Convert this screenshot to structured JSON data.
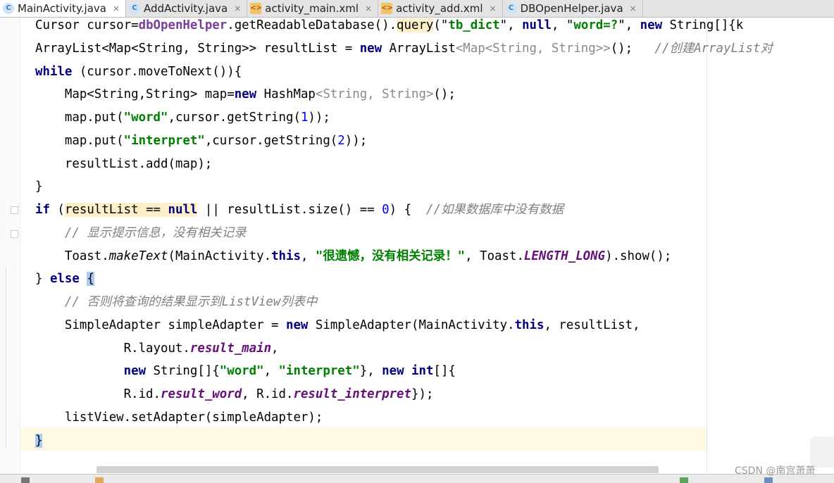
{
  "tabs": [
    {
      "label": "MainActivity.java",
      "icon": "java-class-icon",
      "icon_glyph": "C",
      "active": true
    },
    {
      "label": "AddActivity.java",
      "icon": "java-class-icon",
      "icon_glyph": "C",
      "active": false
    },
    {
      "label": "activity_main.xml",
      "icon": "xml-layout-icon",
      "icon_glyph": "<>",
      "active": false
    },
    {
      "label": "activity_add.xml",
      "icon": "xml-layout-icon",
      "icon_glyph": "<>",
      "active": false
    },
    {
      "label": "DBOpenHelper.java",
      "icon": "java-class-icon",
      "icon_glyph": "C",
      "active": false
    }
  ],
  "tab_close_glyph": "×",
  "code_lines": [
    [
      [
        "Cursor cursor=",
        ""
      ],
      [
        "dbOpenHelper",
        "mth"
      ],
      [
        ".getReadableDatabase().",
        ""
      ],
      [
        "query",
        "hl"
      ],
      [
        "(\"",
        ""
      ],
      [
        "tb_dict",
        "str"
      ],
      [
        "\", ",
        ""
      ],
      [
        "null",
        "kw"
      ],
      [
        ", \"",
        ""
      ],
      [
        "word=?",
        "str"
      ],
      [
        "\", ",
        ""
      ],
      [
        "new",
        "kw"
      ],
      [
        " String[]{k",
        ""
      ]
    ],
    [
      [
        "ArrayList<Map<String, String>> resultList = ",
        ""
      ],
      [
        "new",
        "kw"
      ],
      [
        " ArrayList",
        ""
      ],
      [
        "<Map<String, String>>",
        "gen"
      ],
      [
        "();   ",
        ""
      ],
      [
        "//创建ArrayList对",
        "cm"
      ]
    ],
    [
      [
        "while",
        "kw"
      ],
      [
        " (cursor.moveToNext()){",
        ""
      ]
    ],
    [
      [
        "    Map<String,String> map=",
        ""
      ],
      [
        "new",
        "kw"
      ],
      [
        " HashMap",
        ""
      ],
      [
        "<String, String>",
        "gen"
      ],
      [
        "();",
        ""
      ]
    ],
    [
      [
        "    map.put(",
        ""
      ],
      [
        "\"word\"",
        "str"
      ],
      [
        ",cursor.getString(",
        ""
      ],
      [
        "1",
        "num"
      ],
      [
        "));",
        ""
      ]
    ],
    [
      [
        "    map.put(",
        ""
      ],
      [
        "\"interpret\"",
        "str"
      ],
      [
        ",cursor.getString(",
        ""
      ],
      [
        "2",
        "num"
      ],
      [
        "));",
        ""
      ]
    ],
    [
      [
        "    resultList.add(map);",
        ""
      ]
    ],
    [
      [
        "}",
        ""
      ]
    ],
    [
      [
        "if",
        "kw"
      ],
      [
        " (",
        ""
      ],
      [
        "resultList == ",
        "hl"
      ],
      [
        "null",
        "kw hl"
      ],
      [
        " || resultList.size() == ",
        ""
      ],
      [
        "0",
        "num"
      ],
      [
        ") {  ",
        ""
      ],
      [
        "//如果数据库中没有数据",
        "cm"
      ]
    ],
    [
      [
        "    ",
        ""
      ],
      [
        "// 显示提示信息，没有相关记录",
        "cm"
      ]
    ],
    [
      [
        "    Toast.",
        ""
      ],
      [
        "makeText",
        "it"
      ],
      [
        "(MainActivity.",
        ""
      ],
      [
        "this",
        "kw"
      ],
      [
        ", ",
        ""
      ],
      [
        "\"很遗憾，没有相关记录！\"",
        "str"
      ],
      [
        ", Toast.",
        ""
      ],
      [
        "LENGTH_LONG",
        "fld"
      ],
      [
        ").show();",
        ""
      ]
    ],
    [
      [
        "} ",
        ""
      ],
      [
        "else",
        "kw"
      ],
      [
        " ",
        ""
      ],
      [
        "{",
        "brace"
      ]
    ],
    [
      [
        "    ",
        ""
      ],
      [
        "// 否则将查询的结果显示到ListView列表中",
        "cm"
      ]
    ],
    [
      [
        "    SimpleAdapter simpleAdapter = ",
        ""
      ],
      [
        "new",
        "kw"
      ],
      [
        " SimpleAdapter(MainActivity.",
        ""
      ],
      [
        "this",
        "kw"
      ],
      [
        ", resultList,",
        ""
      ]
    ],
    [
      [
        "            R.layout.",
        ""
      ],
      [
        "result_main",
        "fld"
      ],
      [
        ",",
        ""
      ]
    ],
    [
      [
        "            ",
        ""
      ],
      [
        "new",
        "kw"
      ],
      [
        " String[]{",
        ""
      ],
      [
        "\"word\"",
        "str"
      ],
      [
        ", ",
        ""
      ],
      [
        "\"interpret\"",
        "str"
      ],
      [
        "}, ",
        ""
      ],
      [
        "new",
        "kw"
      ],
      [
        " ",
        ""
      ],
      [
        "int",
        "kw"
      ],
      [
        "[]{",
        ""
      ]
    ],
    [
      [
        "            R.id.",
        ""
      ],
      [
        "result_word",
        "fld"
      ],
      [
        ", R.id.",
        ""
      ],
      [
        "result_interpret",
        "fld"
      ],
      [
        "});",
        ""
      ]
    ],
    [
      [
        "    listView.setAdapter(simpleAdapter);",
        ""
      ]
    ],
    [
      [
        "}",
        "brace"
      ]
    ]
  ],
  "watermark": "CSDN @南宫萧萧"
}
